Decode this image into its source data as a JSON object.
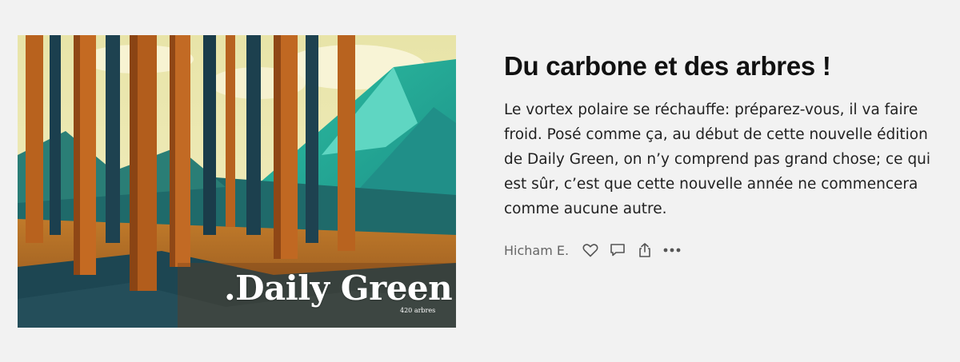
{
  "image": {
    "brand_name": ".Daily Green",
    "brand_subtitle": "420 arbres",
    "icon": "forest-illustration"
  },
  "post": {
    "title": "Du carbone et des arbres !",
    "excerpt": "Le vortex polaire se réchauffe: préparez-vous, il va faire froid. Posé comme ça, au début de cette nouvelle édition de Daily Green, on n’y comprend pas grand chose; ce qui est sûr, c’est que cette nouvelle année ne commencera comme aucune autre.",
    "author": "Hicham E."
  },
  "actions": {
    "like_icon": "heart-icon",
    "comment_icon": "comment-icon",
    "share_icon": "share-icon",
    "more_icon": "more-icon"
  },
  "colors": {
    "background": "#f2f2f2",
    "title": "#111111",
    "text": "#222222",
    "muted": "#666666"
  }
}
